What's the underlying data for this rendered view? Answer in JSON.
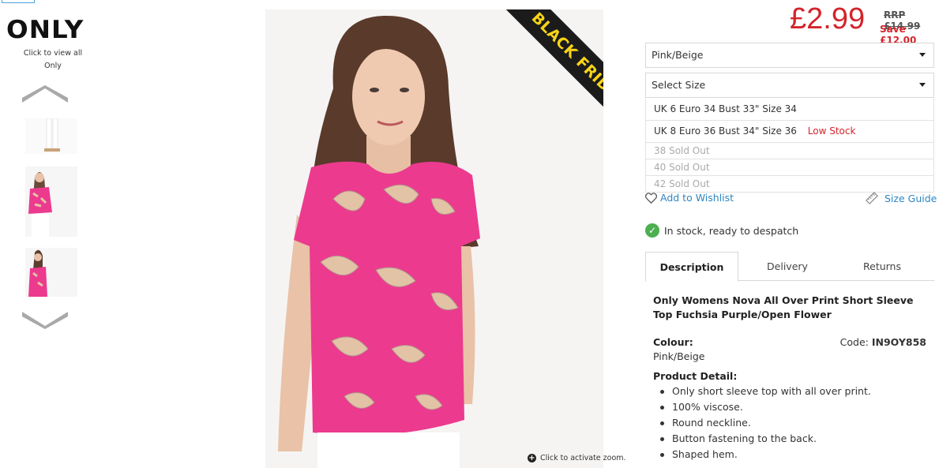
{
  "brand": {
    "logo_text": "ONLY",
    "view_all_line1": "Click to view all",
    "view_all_line2": "Only"
  },
  "main_image": {
    "ribbon_text": "BLACK FRIDAY",
    "zoom_hint": "Click to activate zoom."
  },
  "pricing": {
    "price": "£2.99",
    "rrp_label": "RRP",
    "rrp_value": "£14.99",
    "save": "Save £12.00"
  },
  "colour_select": {
    "selected": "Pink/Beige"
  },
  "size_select": {
    "selected": "Select Size",
    "options": [
      {
        "label": "UK 6 Euro 34 Bust 33\" Size 34",
        "note": ""
      },
      {
        "label": "UK 8 Euro 36 Bust 34\" Size 36",
        "note": "Low Stock"
      },
      {
        "label": "38 Sold Out",
        "note": ""
      },
      {
        "label": "40 Sold Out",
        "note": ""
      },
      {
        "label": "42 Sold Out",
        "note": ""
      }
    ]
  },
  "actions": {
    "wishlist": "Add to Wishlist",
    "size_guide": "Size Guide"
  },
  "stock_status": "In stock, ready to despatch",
  "tabs": [
    "Description",
    "Delivery",
    "Returns"
  ],
  "description": {
    "product_name": "Only Womens Nova All Over Print Short Sleeve Top Fuchsia Purple/Open Flower",
    "colour_label": "Colour:",
    "colour_value": "Pink/Beige",
    "code_label": "Code:",
    "code_value": "IN9OY858",
    "detail_title": "Product Detail:",
    "bullets": [
      "Only short sleeve top with all over print.",
      "100% viscose.",
      "Round neckline.",
      "Button fastening to the back.",
      "Shaped hem."
    ]
  },
  "colors": {
    "price_red": "#d4242b",
    "link_blue": "#2e86c1",
    "ribbon_yellow": "#f7d417",
    "stock_green": "#4caf50",
    "top_pink": "#ec3a8f"
  }
}
